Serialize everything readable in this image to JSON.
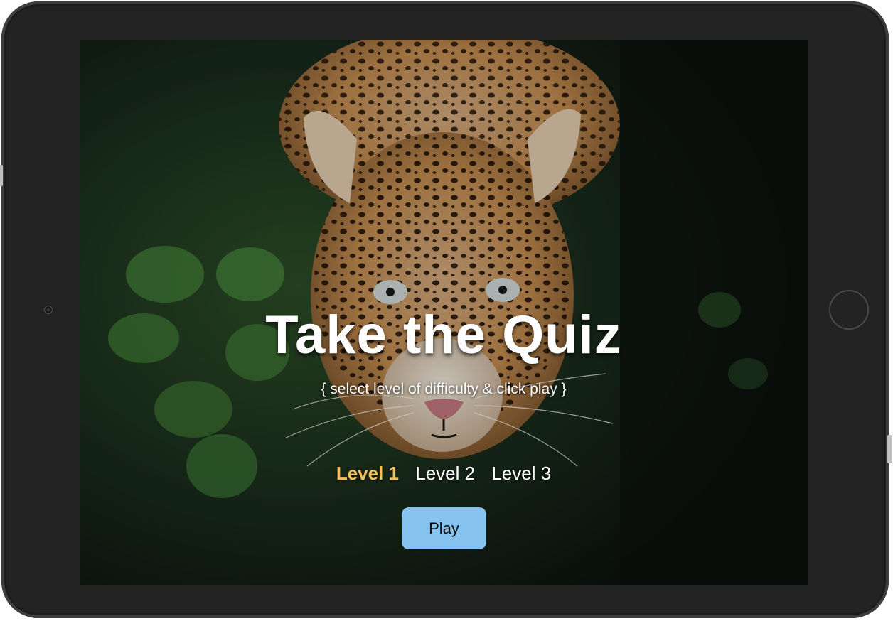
{
  "quiz": {
    "title": "Take the Quiz",
    "subtitle": "{ select level of difficulty & click play }",
    "levels": [
      {
        "label": "Level 1",
        "selected": true
      },
      {
        "label": "Level 2",
        "selected": false
      },
      {
        "label": "Level 3",
        "selected": false
      }
    ],
    "play_label": "Play"
  },
  "colors": {
    "selected_level": "#f0c05c",
    "play_button": "#86c3ef",
    "device_frame": "#232323"
  }
}
